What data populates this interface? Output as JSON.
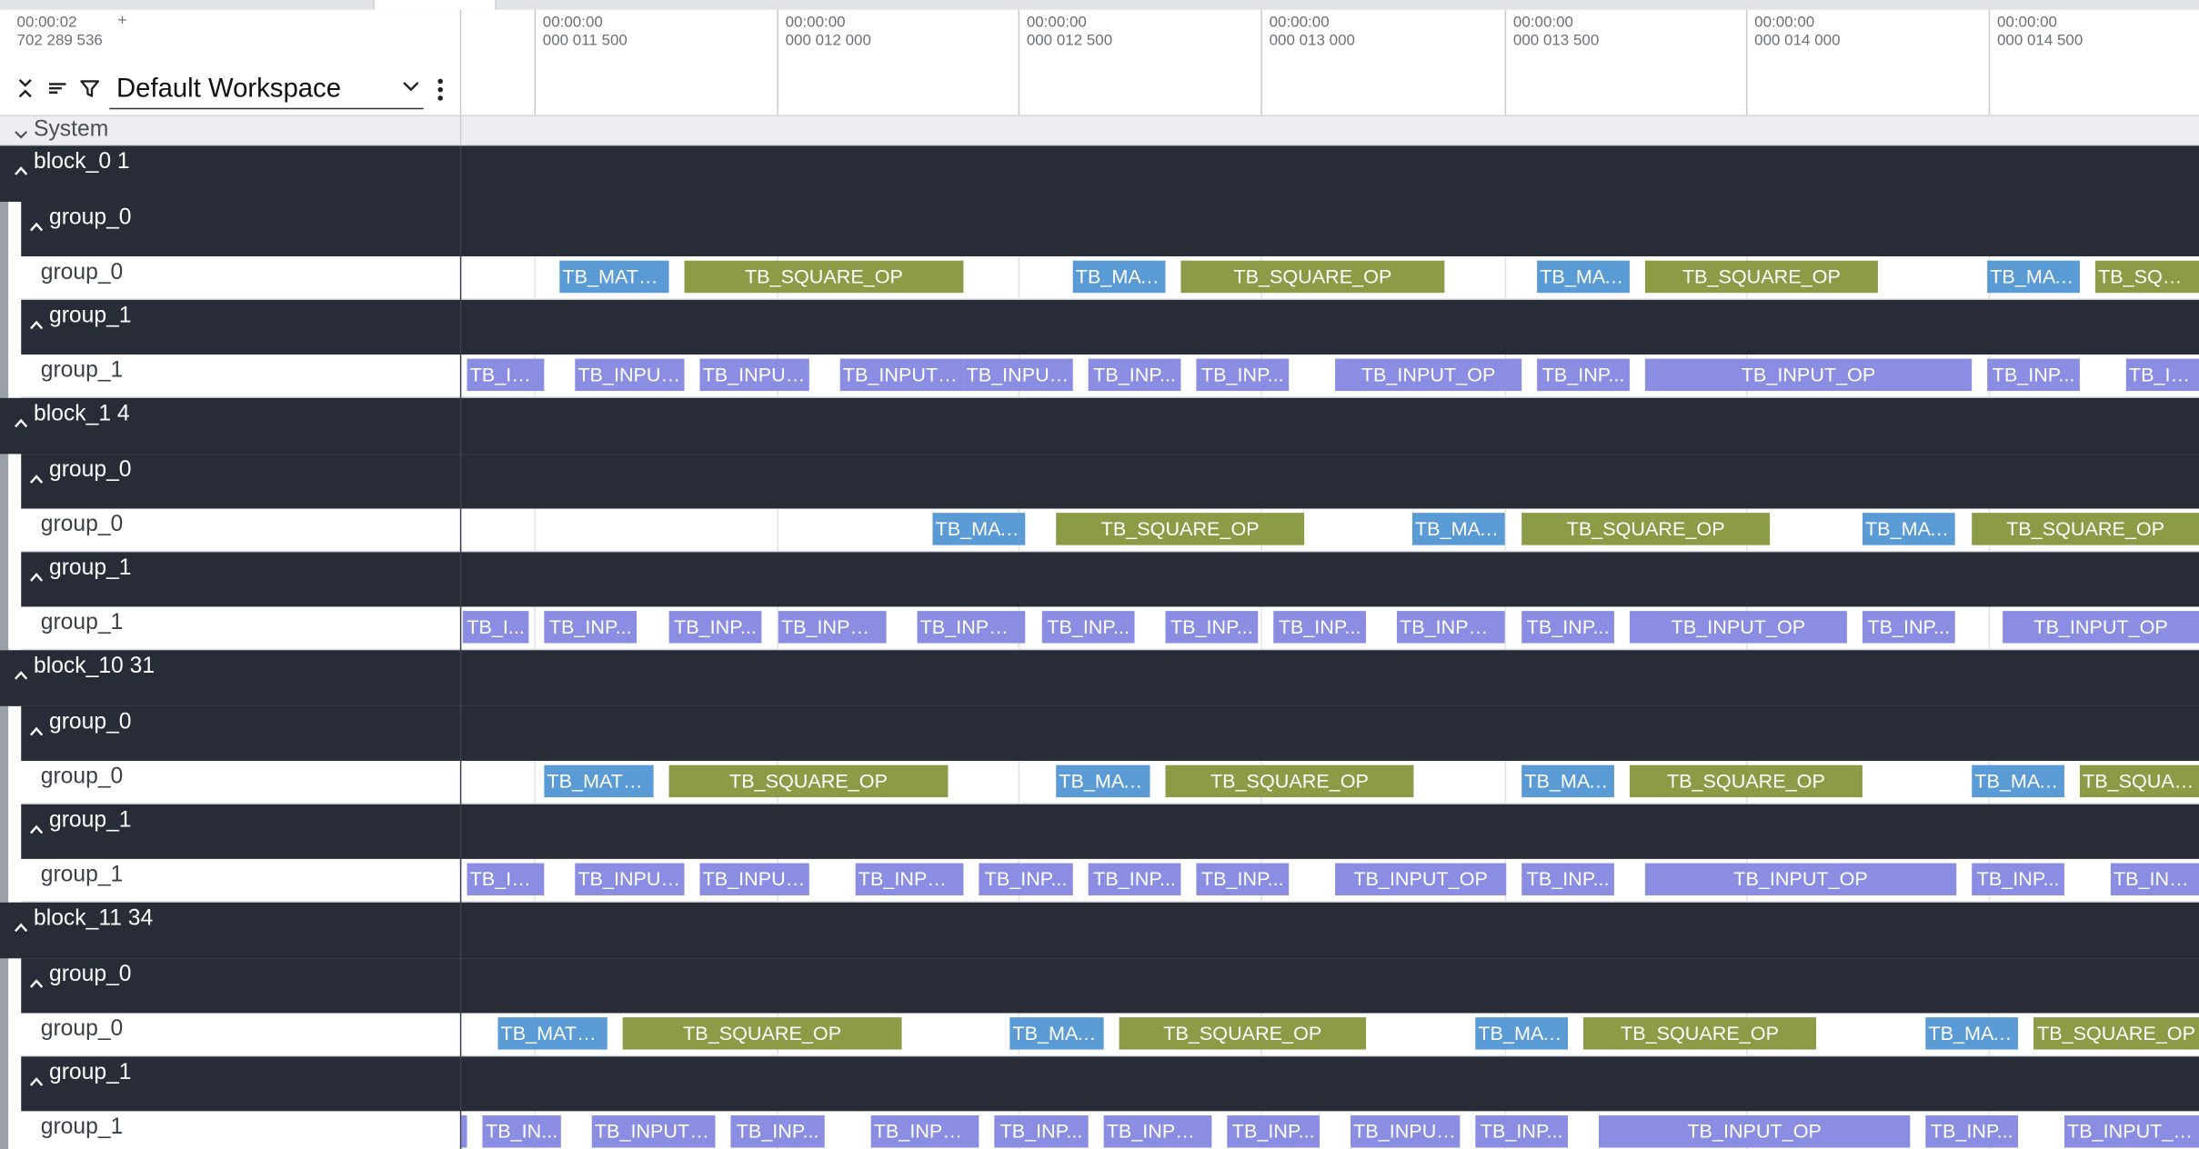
{
  "colors": {
    "matmul": "#5b9bd5",
    "square": "#8c9c46",
    "input": "#8b8de3",
    "dark_row": "#272c37"
  },
  "header": {
    "timestamp_line1": "00:00:02",
    "timestamp_line2": "702 289 536",
    "plus": "+",
    "workspace_label": "Default Workspace",
    "icons": [
      "collapse-all-icon",
      "sort-lines-icon",
      "filter-icon",
      "chevron-down-icon",
      "more-vert-icon"
    ]
  },
  "timeline": {
    "ticks": [
      {
        "l1": "00:00:00",
        "l2": "000 011 500"
      },
      {
        "l1": "00:00:00",
        "l2": "000 012 000"
      },
      {
        "l1": "00:00:00",
        "l2": "000 012 500"
      },
      {
        "l1": "00:00:00",
        "l2": "000 013 000"
      },
      {
        "l1": "00:00:00",
        "l2": "000 013 500"
      },
      {
        "l1": "00:00:00",
        "l2": "000 014 000"
      },
      {
        "l1": "00:00:00",
        "l2": "000 014 500"
      }
    ]
  },
  "system_label": "System",
  "blocks": [
    {
      "label": "block_0 1",
      "groups": [
        {
          "header": "group_0",
          "track_label": "group_0",
          "slices": [
            {
              "t": "TB_MATMU...",
              "k": "matmul",
              "s": 70,
              "e": 148
            },
            {
              "t": "TB_SQUARE_OP",
              "k": "square",
              "s": 159,
              "e": 358
            },
            {
              "t": "TB_MAT...",
              "k": "matmul",
              "s": 436,
              "e": 502
            },
            {
              "t": "TB_SQUARE_OP",
              "k": "square",
              "s": 513,
              "e": 701
            },
            {
              "t": "TB_MAT...",
              "k": "matmul",
              "s": 767,
              "e": 833
            },
            {
              "t": "TB_SQUARE_OP",
              "k": "square",
              "s": 844,
              "e": 1010
            },
            {
              "t": "TB_MAT...",
              "k": "matmul",
              "s": 1088,
              "e": 1154
            },
            {
              "t": "TB_SQUAR...",
              "k": "square",
              "s": 1165,
              "e": 1239
            }
          ]
        },
        {
          "header": "group_1",
          "track_label": "group_1",
          "slices": [
            {
              "t": "TB_IN...",
              "k": "input",
              "s": 4,
              "e": 59
            },
            {
              "t": "TB_INPUT...",
              "k": "input",
              "s": 81,
              "e": 159
            },
            {
              "t": "TB_INPUT...",
              "k": "input",
              "s": 170,
              "e": 248
            },
            {
              "t": "TB_INPUT_...",
              "k": "input",
              "s": 270,
              "e": 358
            },
            {
              "t": "TB_INPUT...",
              "k": "input",
              "s": 358,
              "e": 436
            },
            {
              "t": "TB_INP...",
              "k": "input",
              "s": 447,
              "e": 513
            },
            {
              "t": "TB_INP...",
              "k": "input",
              "s": 524,
              "e": 590
            },
            {
              "t": "TB_INPUT_OP",
              "k": "input",
              "s": 623,
              "e": 756
            },
            {
              "t": "TB_INP...",
              "k": "input",
              "s": 767,
              "e": 833
            },
            {
              "t": "TB_INPUT_OP",
              "k": "input",
              "s": 844,
              "e": 1077
            },
            {
              "t": "TB_INP...",
              "k": "input",
              "s": 1088,
              "e": 1154
            },
            {
              "t": "TB_IN...",
              "k": "input",
              "s": 1187,
              "e": 1239
            }
          ]
        }
      ]
    },
    {
      "label": "block_1 4",
      "groups": [
        {
          "header": "group_0",
          "track_label": "group_0",
          "slices": [
            {
              "t": "TB_MAT...",
              "k": "matmul",
              "s": 336,
              "e": 402
            },
            {
              "t": "TB_SQUARE_OP",
              "k": "square",
              "s": 424,
              "e": 601
            },
            {
              "t": "TB_MAT...",
              "k": "matmul",
              "s": 678,
              "e": 744
            },
            {
              "t": "TB_SQUARE_OP",
              "k": "square",
              "s": 756,
              "e": 933
            },
            {
              "t": "TB_MAT...",
              "k": "matmul",
              "s": 999,
              "e": 1065
            },
            {
              "t": "TB_SQUARE_OP",
              "k": "square",
              "s": 1077,
              "e": 1239
            }
          ]
        },
        {
          "header": "group_1",
          "track_label": "group_1",
          "slices": [
            {
              "t": "TB_I...",
              "k": "input",
              "s": 1,
              "e": 48
            },
            {
              "t": "TB_INP...",
              "k": "input",
              "s": 59,
              "e": 125
            },
            {
              "t": "TB_INP...",
              "k": "input",
              "s": 148,
              "e": 214
            },
            {
              "t": "TB_INPUT...",
              "k": "input",
              "s": 226,
              "e": 303
            },
            {
              "t": "TB_INPUT...",
              "k": "input",
              "s": 325,
              "e": 402
            },
            {
              "t": "TB_INP...",
              "k": "input",
              "s": 414,
              "e": 480
            },
            {
              "t": "TB_INP...",
              "k": "input",
              "s": 502,
              "e": 568
            },
            {
              "t": "TB_INP...",
              "k": "input",
              "s": 579,
              "e": 645
            },
            {
              "t": "TB_INPUT...",
              "k": "input",
              "s": 667,
              "e": 744
            },
            {
              "t": "TB_INP...",
              "k": "input",
              "s": 756,
              "e": 822
            },
            {
              "t": "TB_INPUT_OP",
              "k": "input",
              "s": 833,
              "e": 988
            },
            {
              "t": "TB_INP...",
              "k": "input",
              "s": 999,
              "e": 1065
            },
            {
              "t": "TB_INPUT_OP",
              "k": "input",
              "s": 1099,
              "e": 1239
            }
          ]
        }
      ]
    },
    {
      "label": "block_10 31",
      "groups": [
        {
          "header": "group_0",
          "track_label": "group_0",
          "slices": [
            {
              "t": "TB_MATMU...",
              "k": "matmul",
              "s": 59,
              "e": 137
            },
            {
              "t": "TB_SQUARE_OP",
              "k": "square",
              "s": 148,
              "e": 347
            },
            {
              "t": "TB_MAT...",
              "k": "matmul",
              "s": 424,
              "e": 491
            },
            {
              "t": "TB_SQUARE_OP",
              "k": "square",
              "s": 502,
              "e": 679
            },
            {
              "t": "TB_MAT...",
              "k": "matmul",
              "s": 756,
              "e": 822
            },
            {
              "t": "TB_SQUARE_OP",
              "k": "square",
              "s": 833,
              "e": 999
            },
            {
              "t": "TB_MAT...",
              "k": "matmul",
              "s": 1077,
              "e": 1143
            },
            {
              "t": "TB_SQUARE_...",
              "k": "square",
              "s": 1154,
              "e": 1239
            }
          ]
        },
        {
          "header": "group_1",
          "track_label": "group_1",
          "slices": [
            {
              "t": "TB_IN...",
              "k": "input",
              "s": 4,
              "e": 59
            },
            {
              "t": "TB_INPUT...",
              "k": "input",
              "s": 81,
              "e": 159
            },
            {
              "t": "TB_INPUT...",
              "k": "input",
              "s": 170,
              "e": 248
            },
            {
              "t": "TB_INPUT...",
              "k": "input",
              "s": 281,
              "e": 358
            },
            {
              "t": "TB_INP...",
              "k": "input",
              "s": 369,
              "e": 436
            },
            {
              "t": "TB_INP...",
              "k": "input",
              "s": 447,
              "e": 513
            },
            {
              "t": "TB_INP...",
              "k": "input",
              "s": 524,
              "e": 590
            },
            {
              "t": "TB_INPUT_OP",
              "k": "input",
              "s": 623,
              "e": 745
            },
            {
              "t": "TB_INP...",
              "k": "input",
              "s": 756,
              "e": 822
            },
            {
              "t": "TB_INPUT_OP",
              "k": "input",
              "s": 844,
              "e": 1066
            },
            {
              "t": "TB_INP...",
              "k": "input",
              "s": 1077,
              "e": 1143
            },
            {
              "t": "TB_INPU...",
              "k": "input",
              "s": 1176,
              "e": 1239
            }
          ]
        }
      ]
    },
    {
      "label": "block_11 34",
      "groups": [
        {
          "header": "group_0",
          "track_label": "group_0",
          "slices": [
            {
              "t": "TB_MATMU...",
              "k": "matmul",
              "s": 26,
              "e": 104
            },
            {
              "t": "TB_SQUARE_OP",
              "k": "square",
              "s": 115,
              "e": 314
            },
            {
              "t": "TB_MAT...",
              "k": "matmul",
              "s": 391,
              "e": 458
            },
            {
              "t": "TB_SQUARE_OP",
              "k": "square",
              "s": 469,
              "e": 645
            },
            {
              "t": "TB_MAT...",
              "k": "matmul",
              "s": 723,
              "e": 789
            },
            {
              "t": "TB_SQUARE_OP",
              "k": "square",
              "s": 800,
              "e": 966
            },
            {
              "t": "TB_MAT...",
              "k": "matmul",
              "s": 1044,
              "e": 1110
            },
            {
              "t": "TB_SQUARE_OP",
              "k": "square",
              "s": 1121,
              "e": 1239
            }
          ]
        },
        {
          "header": "group_1",
          "track_label": "group_1",
          "slices": [
            {
              "t": "",
              "k": "input",
              "s": 0,
              "e": 4
            },
            {
              "t": "TB_IN...",
              "k": "input",
              "s": 15,
              "e": 71
            },
            {
              "t": "TB_INPUT_...",
              "k": "input",
              "s": 93,
              "e": 181
            },
            {
              "t": "TB_INP...",
              "k": "input",
              "s": 192,
              "e": 259
            },
            {
              "t": "TB_INPUT...",
              "k": "input",
              "s": 292,
              "e": 369
            },
            {
              "t": "TB_INP...",
              "k": "input",
              "s": 380,
              "e": 447
            },
            {
              "t": "TB_INPUT...",
              "k": "input",
              "s": 458,
              "e": 535
            },
            {
              "t": "TB_INP...",
              "k": "input",
              "s": 546,
              "e": 612
            },
            {
              "t": "TB_INPUT...",
              "k": "input",
              "s": 634,
              "e": 712
            },
            {
              "t": "TB_INP...",
              "k": "input",
              "s": 723,
              "e": 789
            },
            {
              "t": "TB_INPUT_OP",
              "k": "input",
              "s": 811,
              "e": 1033
            },
            {
              "t": "TB_INP...",
              "k": "input",
              "s": 1044,
              "e": 1110
            },
            {
              "t": "TB_INPUT_OP",
              "k": "input",
              "s": 1143,
              "e": 1239
            }
          ]
        }
      ]
    }
  ]
}
